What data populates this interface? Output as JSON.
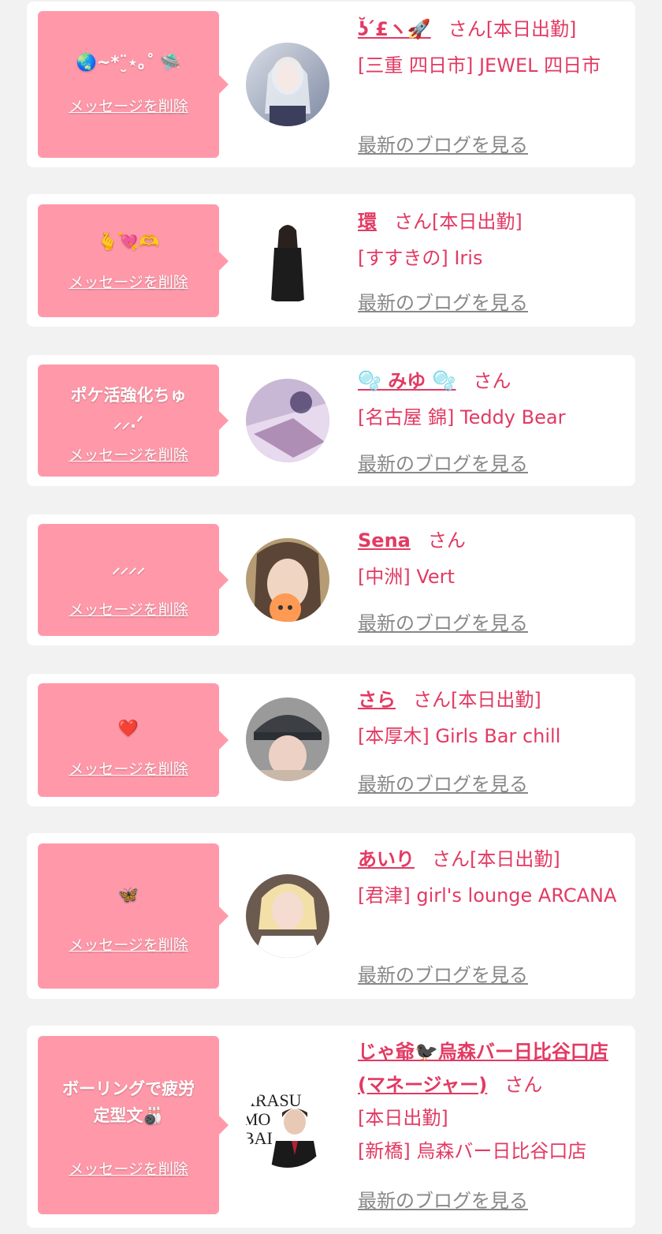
{
  "delete_label": "メッセージを削除",
  "blog_label": "最新のブログを見る",
  "san": "さん",
  "colors": {
    "accent": "#e23a63",
    "bubble": "#ff99aa",
    "link_gray": "#888888",
    "background": "#f2f2f2"
  },
  "items": [
    {
      "message": "🌏~*¨̮⋆｡˚ 🛸",
      "name": "ʖ̆ ́£ヽ🚀",
      "status": "[本日出勤]",
      "shop": "[三重 四日市] JEWEL 四日市",
      "avatar_icon": "avatar-photo"
    },
    {
      "message": "🫰💘🫶",
      "name": "環",
      "status": "[本日出勤]",
      "shop": "[すすきの] Iris",
      "avatar_icon": "avatar-photo"
    },
    {
      "message": "ポケ活強化ちゅ\n⸝⸝.ᐟ",
      "name": "🫧 みゆ 🫧",
      "status": "",
      "shop": "[名古屋 錦] Teddy Bear",
      "avatar_icon": "avatar-photo"
    },
    {
      "message": "⸝⸝⸝⸝",
      "name": "Sena",
      "status": "",
      "shop": "[中洲] Vert",
      "avatar_icon": "avatar-photo"
    },
    {
      "message": "❤️",
      "name": "さら",
      "status": "[本日出勤]",
      "shop": "[本厚木] Girls Bar chill",
      "avatar_icon": "avatar-photo"
    },
    {
      "message": "🦋",
      "name": "あいり",
      "status": "[本日出勤]",
      "shop": "[君津] girl's lounge ARCANA",
      "avatar_icon": "avatar-photo"
    },
    {
      "message": "ボーリングで疲労\n定型文🎳",
      "name": "じゃ爺🐦‍⬛烏森バー日比谷口店(マネージャー)",
      "status": "[本日出勤]",
      "shop": "[新橋] 烏森バー日比谷口店",
      "avatar_icon": "avatar-photo"
    }
  ]
}
